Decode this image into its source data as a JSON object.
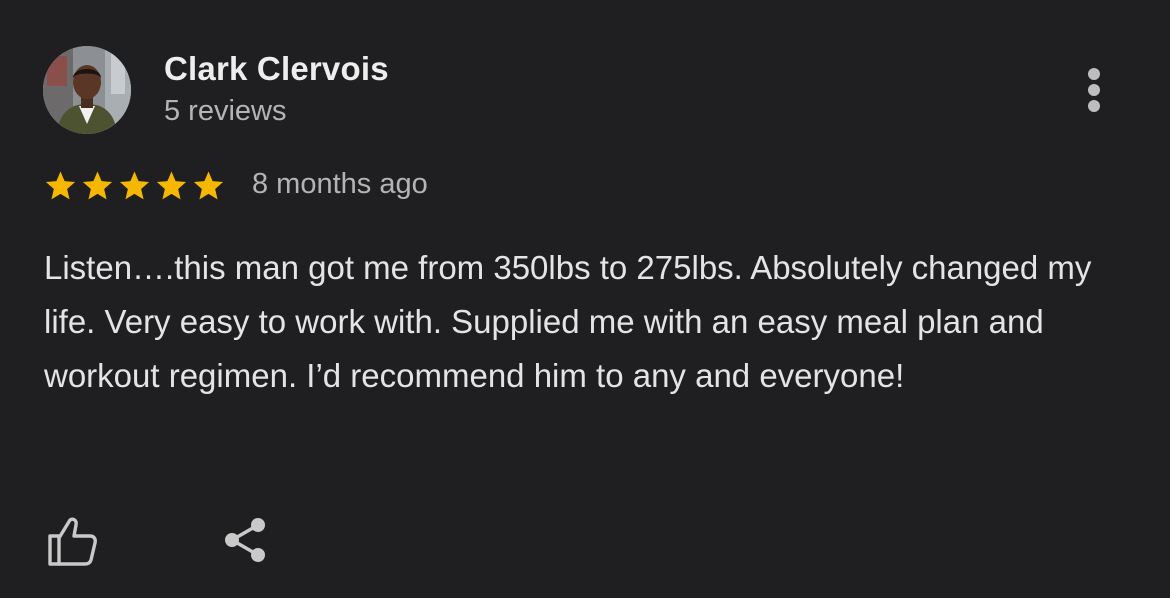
{
  "reviewer": {
    "name": "Clark Clervois",
    "review_count": "5 reviews",
    "avatar_icon": "person-photo"
  },
  "review": {
    "rating": 5,
    "max_rating": 5,
    "date": "8 months ago",
    "text": "Listen….this man got me from 350lbs to 275lbs. Absolutely changed my life. Very easy to work with. Supplied me with an easy meal plan and workout regimen. I’d recommend him to any and everyone!"
  },
  "actions": {
    "more_icon": "more-vertical-icon",
    "like_icon": "thumbs-up-icon",
    "share_icon": "share-icon"
  },
  "colors": {
    "background": "#1f1f21",
    "star": "#f5b700",
    "primary_text": "#ededed",
    "secondary_text": "#b4b4b4",
    "icon": "#bdbdbd"
  }
}
